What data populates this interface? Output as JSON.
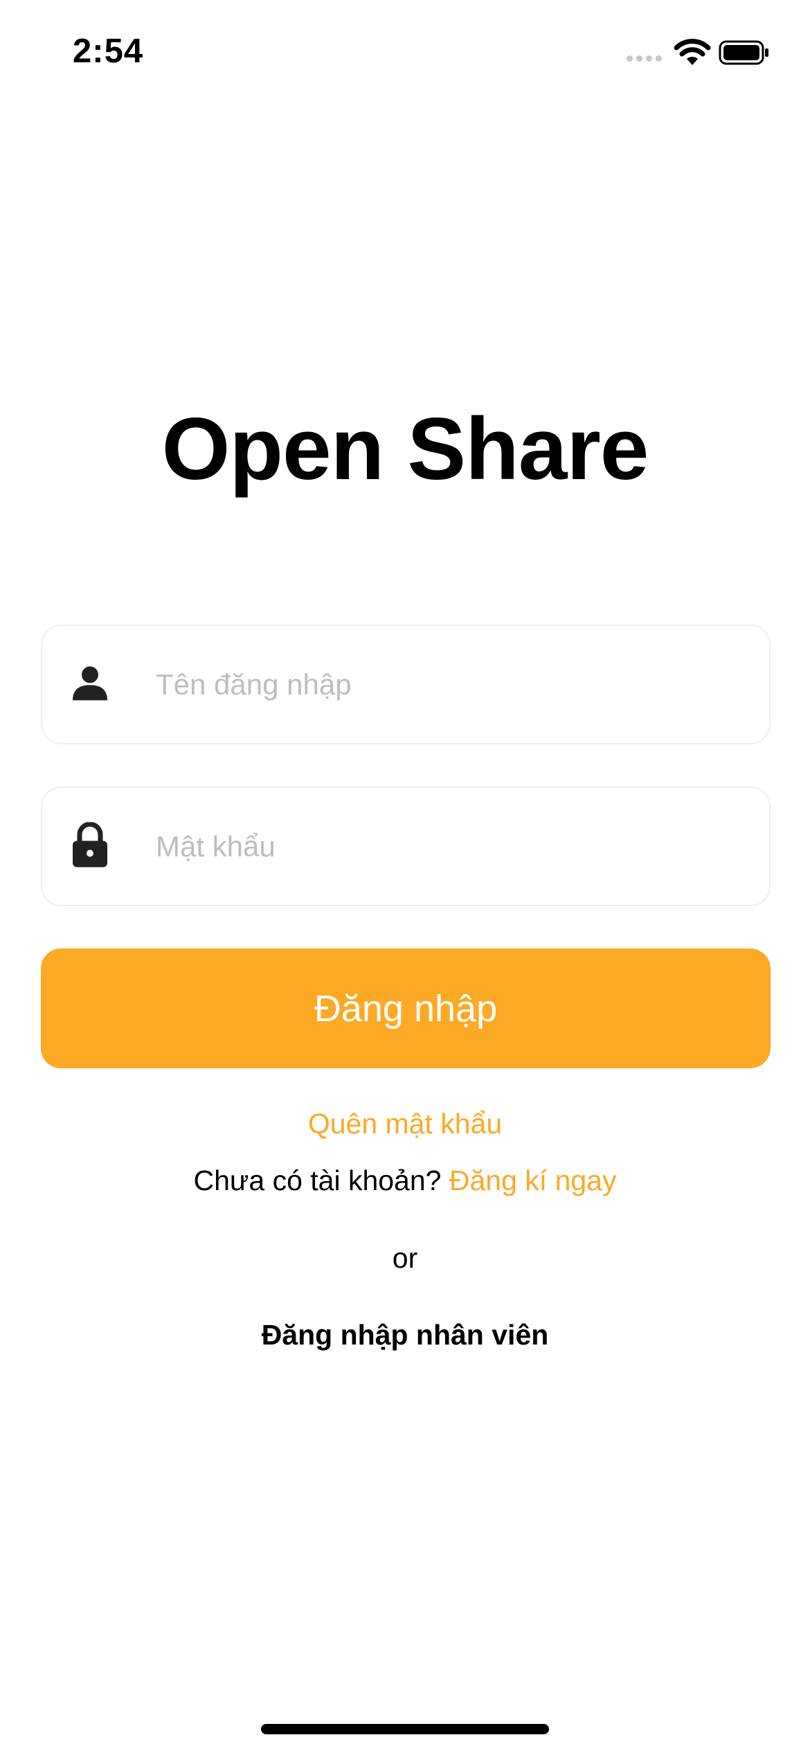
{
  "status_bar": {
    "time": "2:54",
    "icons": [
      "cellular-signal-icon",
      "wifi-icon",
      "battery-icon"
    ]
  },
  "app_title": "Open Share",
  "form": {
    "username_placeholder": "Tên đăng nhập",
    "username_value": "",
    "username_icon": "user-icon",
    "password_placeholder": "Mật khẩu",
    "password_value": "",
    "password_icon": "lock-icon",
    "login_label": "Đăng nhập"
  },
  "links": {
    "forgot_password": "Quên mật khẩu",
    "no_account_text": "Chưa có tài khoản?",
    "signup_now": "Đăng kí ngay",
    "or_text": "or",
    "employee_login": "Đăng nhập nhân viên"
  },
  "colors": {
    "accent": "#FCA926",
    "placeholder": "#bdbdbd",
    "field_border": "#eeeeee",
    "text": "#000000"
  }
}
